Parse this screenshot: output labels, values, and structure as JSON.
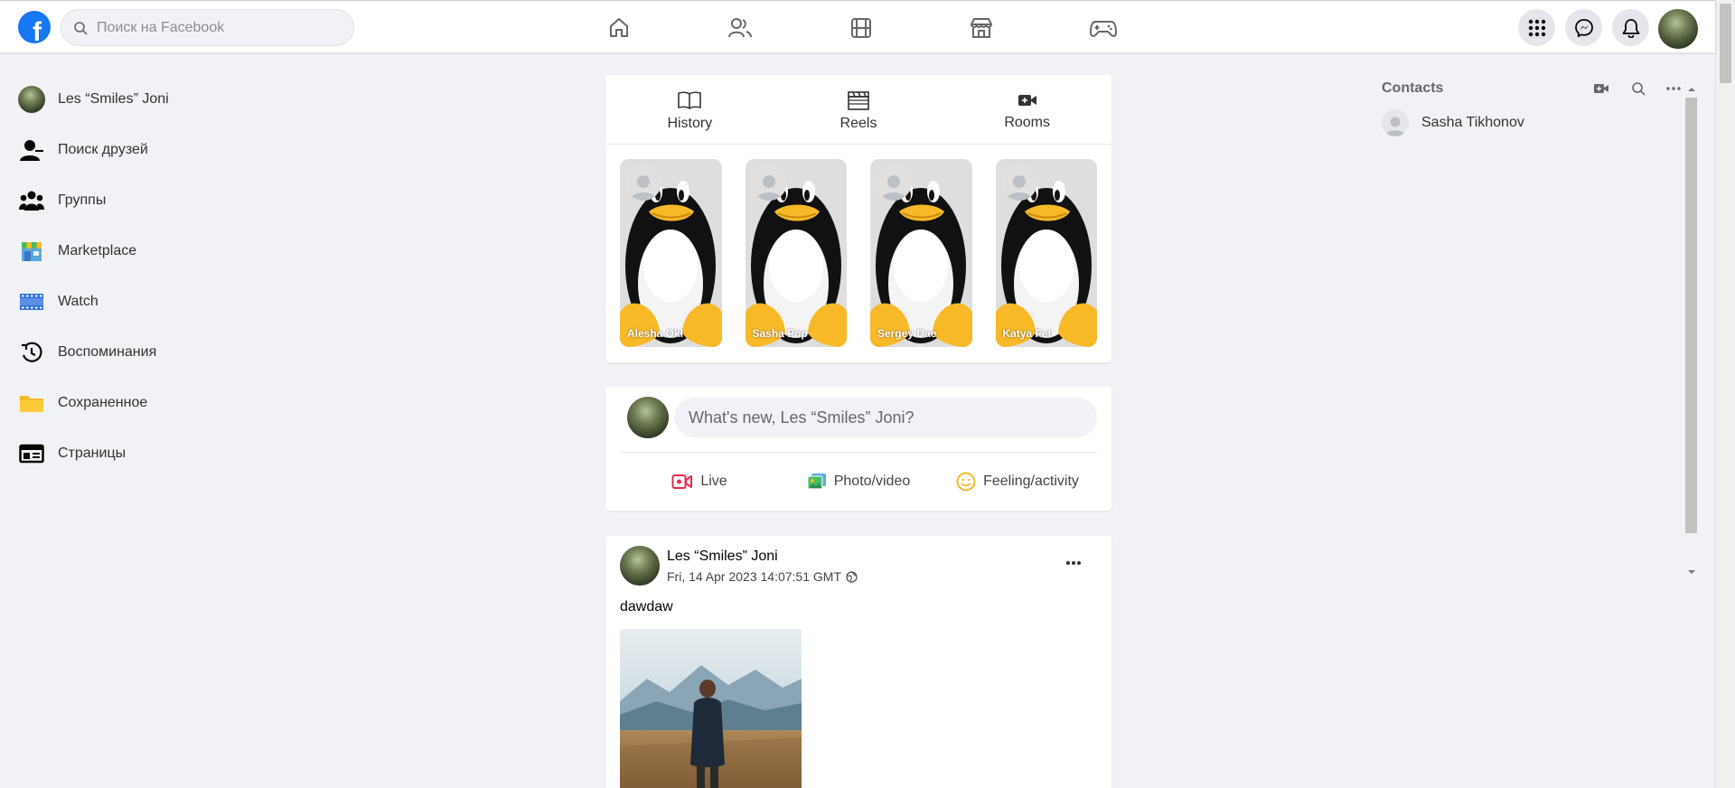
{
  "header": {
    "logo_letter": "f",
    "search_placeholder": "Поиск на Facebook",
    "nav_icons": [
      "home-icon",
      "friends-icon",
      "video-icon",
      "marketplace-icon",
      "gaming-icon"
    ],
    "right_icons": [
      "menu-grid-icon",
      "messenger-icon",
      "notifications-icon"
    ]
  },
  "sidebar": {
    "items": [
      {
        "label": "Les “Smiles” Joni",
        "icon": "avatar"
      },
      {
        "label": "Поиск друзей",
        "icon": "find-friends-icon"
      },
      {
        "label": "Группы",
        "icon": "groups-icon"
      },
      {
        "label": "Marketplace",
        "icon": "marketplace-icon"
      },
      {
        "label": "Watch",
        "icon": "watch-icon"
      },
      {
        "label": "Воспоминания",
        "icon": "memories-icon"
      },
      {
        "label": "Сохраненное",
        "icon": "saved-folder-icon"
      },
      {
        "label": "Страницы",
        "icon": "pages-icon"
      }
    ]
  },
  "stories": {
    "tabs": [
      {
        "label": "History",
        "icon": "book-icon"
      },
      {
        "label": "Reels",
        "icon": "clapperboard-icon"
      },
      {
        "label": "Rooms",
        "icon": "video-add-icon"
      }
    ],
    "items": [
      {
        "name": "Alesha Okl"
      },
      {
        "name": "Sasha Pop"
      },
      {
        "name": "Sergey Dae"
      },
      {
        "name": "Katya Fet"
      }
    ]
  },
  "composer": {
    "placeholder": "What's new, Les “Smiles” Joni?",
    "actions": [
      {
        "label": "Live",
        "icon": "live-video-icon",
        "color": "#f02849"
      },
      {
        "label": "Photo/video",
        "icon": "photo-icon",
        "color": "#45bd62"
      },
      {
        "label": "Feeling/activity",
        "icon": "smiley-icon",
        "color": "#f7b928"
      }
    ]
  },
  "post": {
    "author": "Les “Smiles” Joni",
    "date": "Fri, 14 Apr 2023 14:07:51 GMT",
    "text": "dawdaw"
  },
  "contacts": {
    "title": "Contacts",
    "items": [
      {
        "name": "Sasha Tikhonov"
      }
    ]
  },
  "colors": {
    "brand": "#1877f2",
    "background": "#f0f2f5"
  }
}
